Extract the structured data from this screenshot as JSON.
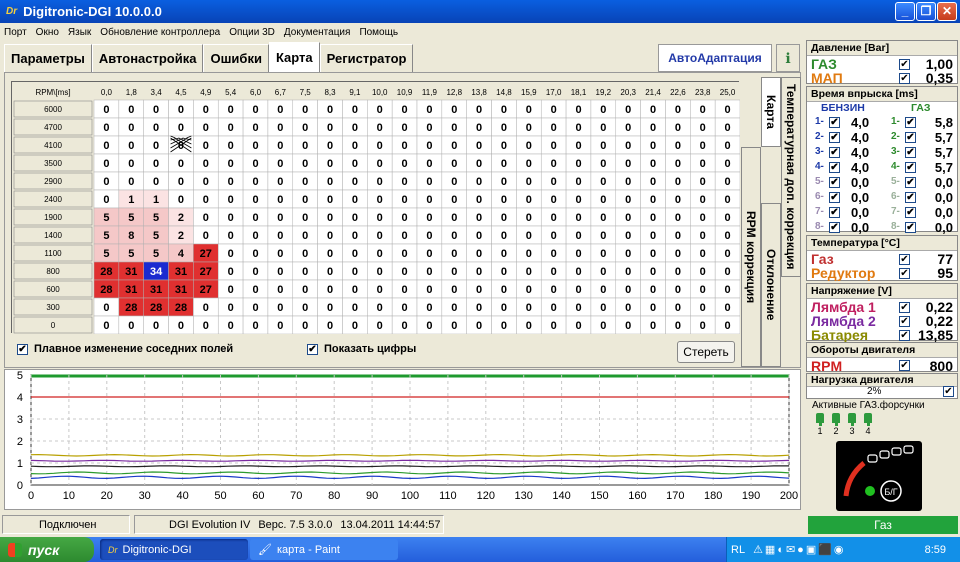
{
  "window": {
    "title": "Digitronic-DGI  10.0.0.0",
    "logo": "Dr"
  },
  "menu": [
    "Порт",
    "Окно",
    "Язык",
    "Обновление контроллера",
    "Опции 3D",
    "Документация",
    "Помощь"
  ],
  "tabs": [
    "Параметры",
    "Автонастройка",
    "Ошибки",
    "Карта",
    "Регистратор"
  ],
  "active_tab": "Карта",
  "autoadapt_label": "АвтоАдаптация",
  "map": {
    "corner_label": "RPM\\[ms]",
    "columns": [
      "0,0",
      "1,8",
      "3,4",
      "4,5",
      "4,9",
      "5,4",
      "6,0",
      "6,7",
      "7,5",
      "8,3",
      "9,1",
      "10,0",
      "10,9",
      "11,9",
      "12,8",
      "13,8",
      "14,8",
      "15,9",
      "17,0",
      "18,1",
      "19,2",
      "20,3",
      "21,4",
      "22,6",
      "23,8",
      "25,0"
    ],
    "rows": [
      {
        "rpm": "6000",
        "v": [
          0,
          0,
          0,
          0,
          0,
          0,
          0,
          0,
          0,
          0,
          0,
          0,
          0,
          0,
          0,
          0,
          0,
          0,
          0,
          0,
          0,
          0,
          0,
          0,
          0,
          0
        ]
      },
      {
        "rpm": "4700",
        "v": [
          0,
          0,
          0,
          0,
          0,
          0,
          0,
          0,
          0,
          0,
          0,
          0,
          0,
          0,
          0,
          0,
          0,
          0,
          0,
          0,
          0,
          0,
          0,
          0,
          0,
          0
        ]
      },
      {
        "rpm": "4100",
        "v": [
          0,
          0,
          0,
          0,
          0,
          0,
          0,
          0,
          0,
          0,
          0,
          0,
          0,
          0,
          0,
          0,
          0,
          0,
          0,
          0,
          0,
          0,
          0,
          0,
          0,
          0
        ]
      },
      {
        "rpm": "3500",
        "v": [
          0,
          0,
          0,
          0,
          0,
          0,
          0,
          0,
          0,
          0,
          0,
          0,
          0,
          0,
          0,
          0,
          0,
          0,
          0,
          0,
          0,
          0,
          0,
          0,
          0,
          0
        ]
      },
      {
        "rpm": "2900",
        "v": [
          0,
          0,
          0,
          0,
          0,
          0,
          0,
          0,
          0,
          0,
          0,
          0,
          0,
          0,
          0,
          0,
          0,
          0,
          0,
          0,
          0,
          0,
          0,
          0,
          0,
          0
        ]
      },
      {
        "rpm": "2400",
        "v": [
          0,
          1,
          1,
          0,
          0,
          0,
          0,
          0,
          0,
          0,
          0,
          0,
          0,
          0,
          0,
          0,
          0,
          0,
          0,
          0,
          0,
          0,
          0,
          0,
          0,
          0
        ]
      },
      {
        "rpm": "1900",
        "v": [
          5,
          5,
          5,
          2,
          0,
          0,
          0,
          0,
          0,
          0,
          0,
          0,
          0,
          0,
          0,
          0,
          0,
          0,
          0,
          0,
          0,
          0,
          0,
          0,
          0,
          0
        ]
      },
      {
        "rpm": "1400",
        "v": [
          5,
          8,
          5,
          2,
          0,
          0,
          0,
          0,
          0,
          0,
          0,
          0,
          0,
          0,
          0,
          0,
          0,
          0,
          0,
          0,
          0,
          0,
          0,
          0,
          0,
          0
        ]
      },
      {
        "rpm": "1100",
        "v": [
          5,
          5,
          5,
          4,
          27,
          0,
          0,
          0,
          0,
          0,
          0,
          0,
          0,
          0,
          0,
          0,
          0,
          0,
          0,
          0,
          0,
          0,
          0,
          0,
          0,
          0
        ]
      },
      {
        "rpm": "800",
        "v": [
          28,
          31,
          34,
          31,
          27,
          0,
          0,
          0,
          0,
          0,
          0,
          0,
          0,
          0,
          0,
          0,
          0,
          0,
          0,
          0,
          0,
          0,
          0,
          0,
          0,
          0
        ]
      },
      {
        "rpm": "600",
        "v": [
          28,
          31,
          31,
          31,
          27,
          0,
          0,
          0,
          0,
          0,
          0,
          0,
          0,
          0,
          0,
          0,
          0,
          0,
          0,
          0,
          0,
          0,
          0,
          0,
          0,
          0
        ]
      },
      {
        "rpm": "300",
        "v": [
          0,
          28,
          28,
          28,
          0,
          0,
          0,
          0,
          0,
          0,
          0,
          0,
          0,
          0,
          0,
          0,
          0,
          0,
          0,
          0,
          0,
          0,
          0,
          0,
          0,
          0
        ]
      },
      {
        "rpm": "0",
        "v": [
          0,
          0,
          0,
          0,
          0,
          0,
          0,
          0,
          0,
          0,
          0,
          0,
          0,
          0,
          0,
          0,
          0,
          0,
          0,
          0,
          0,
          0,
          0,
          0,
          0,
          0
        ]
      }
    ],
    "selected_cell": {
      "row": 9,
      "col": 2
    },
    "marker_cell": {
      "row": 2,
      "col": 3
    },
    "smooth_label": "Плавное изменение соседних полей",
    "show_digits_label": "Показать цифры",
    "clear_label": "Стереть"
  },
  "side_tabs": [
    "Карта",
    "RPM коррекция",
    "Температурная доп. коррекция",
    "Отклонение"
  ],
  "graph": {
    "x_ticks": [
      "0",
      "10",
      "20",
      "30",
      "40",
      "50",
      "60",
      "70",
      "80",
      "90",
      "100",
      "110",
      "120",
      "130",
      "140",
      "150",
      "160",
      "170",
      "180",
      "190",
      "200"
    ],
    "y_ticks": [
      "0",
      "1",
      "2",
      "3",
      "4",
      "5"
    ],
    "series_colors": [
      "#b8a000",
      "#7a2aa0",
      "#2d9a2d",
      "#1a3ac8",
      "#d02020",
      "#222222"
    ]
  },
  "right_panel": {
    "pressure": {
      "title": "Давление [Bar]",
      "gas_label": "ГАЗ",
      "gas": "1,00",
      "map_label": "МАП",
      "map": "0,35"
    },
    "injection": {
      "title": "Время впрыска [ms]",
      "petrol_label": "БЕНЗИН",
      "gas_label": "ГАЗ",
      "rows": [
        {
          "n": "1-",
          "p": "4,0",
          "g": "5,8"
        },
        {
          "n": "2-",
          "p": "4,0",
          "g": "5,7"
        },
        {
          "n": "3-",
          "p": "4,0",
          "g": "5,7"
        },
        {
          "n": "4-",
          "p": "4,0",
          "g": "5,7"
        },
        {
          "n": "5-",
          "p": "0,0",
          "g": "0,0"
        },
        {
          "n": "6-",
          "p": "0,0",
          "g": "0,0"
        },
        {
          "n": "7-",
          "p": "0,0",
          "g": "0,0"
        },
        {
          "n": "8-",
          "p": "0,0",
          "g": "0,0"
        }
      ]
    },
    "temperature": {
      "title": "Температура [°C]",
      "gas_label": "Газ",
      "gas": "77",
      "reducer_label": "Редуктор",
      "reducer": "95"
    },
    "voltage": {
      "title": "Напряжение [V]",
      "l1_label": "Лямбда 1",
      "l1": "0,22",
      "l2_label": "Лямбда 2",
      "l2": "0,22",
      "bat_label": "Батарея",
      "bat": "13,85"
    },
    "rpm": {
      "title": "Обороты двигателя",
      "label": "RPM",
      "value": "800"
    },
    "load": {
      "title": "Нагрузка двигателя",
      "value": "2%"
    },
    "injectors": {
      "title": "Активные ГАЗ.форсунки",
      "numbers": [
        "1",
        "2",
        "3",
        "4"
      ]
    },
    "gauge_label": "Б/Г"
  },
  "status": {
    "connection": "Подключен",
    "device": "DGI Evolution IV",
    "version": "Верс. 7.5  3.0.0",
    "datetime": "13.04.2011 14:44:57",
    "mode": "Газ"
  },
  "taskbar": {
    "start": "пуск",
    "task1": "Digitronic-DGI",
    "task2": "карта - Paint",
    "lang": "RL",
    "clock": "8:59"
  },
  "colors": {
    "cell_red": "#e03030",
    "cell_pink": "#f5c8c8",
    "cell_light": "#fbe3e3",
    "selected": "#1a2ad0"
  }
}
